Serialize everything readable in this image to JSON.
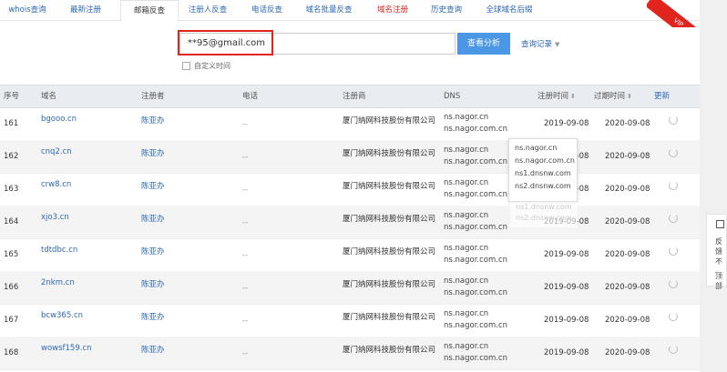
{
  "tabs": [
    {
      "label": "whois查询",
      "state": "normal"
    },
    {
      "label": "最新注册",
      "state": "normal"
    },
    {
      "label": "邮箱反查",
      "state": "active"
    },
    {
      "label": "注册人反查",
      "state": "normal"
    },
    {
      "label": "电话反查",
      "state": "normal"
    },
    {
      "label": "域名批量反查",
      "state": "normal"
    },
    {
      "label": "域名注册",
      "state": "red"
    },
    {
      "label": "历史查询",
      "state": "normal"
    },
    {
      "label": "全球域名后缀",
      "state": "normal"
    }
  ],
  "vip_ribbon": "VIP",
  "search": {
    "value": "**95@gmail.com",
    "button": "查看分析",
    "history": "查询记录",
    "custom_time": "自定义时间"
  },
  "table": {
    "headers": {
      "seq": "序号",
      "domain": "域名",
      "registrant": "注册者",
      "phone": "电话",
      "registrar": "注册商",
      "dns": "DNS",
      "reg_time": "注册时间",
      "exp_time": "过期时间",
      "refresh": "更新"
    },
    "rows": [
      {
        "seq": "161",
        "domain": "bgooo.cn",
        "registrant": "陈亚办",
        "phone": "--",
        "registrar": "厦门纳网科技股份有限公司",
        "dns1": "ns.nagor.cn",
        "dns2": "ns.nagor.com.cn",
        "reg": "2019-09-08",
        "exp": "2020-09-08"
      },
      {
        "seq": "162",
        "domain": "cnq2.cn",
        "registrant": "陈亚办",
        "phone": "--",
        "registrar": "厦门纳网科技股份有限公司",
        "dns1": "ns.nagor.cn",
        "dns2": "ns.nagor.com.cn",
        "reg": "2019-09-08",
        "exp": "2020-09-08"
      },
      {
        "seq": "163",
        "domain": "crw8.cn",
        "registrant": "陈亚办",
        "phone": "--",
        "registrar": "厦门纳网科技股份有限公司",
        "dns1": "ns.nagor.cn",
        "dns2": "ns.nagor.com.cn",
        "reg": "2019-09-08",
        "exp": "2020-09-08"
      },
      {
        "seq": "164",
        "domain": "xjo3.cn",
        "registrant": "陈亚办",
        "phone": "--",
        "registrar": "厦门纳网科技股份有限公司",
        "dns1": "ns.nagor.cn",
        "dns2": "ns.nagor.com.cn",
        "reg": "2019-09-08",
        "exp": "2020-09-08"
      },
      {
        "seq": "165",
        "domain": "tdtdbc.cn",
        "registrant": "陈亚办",
        "phone": "--",
        "registrar": "厦门纳网科技股份有限公司",
        "dns1": "ns.nagor.cn",
        "dns2": "ns.nagor.com.cn",
        "reg": "2019-09-08",
        "exp": "2020-09-08"
      },
      {
        "seq": "166",
        "domain": "2nkm.cn",
        "registrant": "陈亚办",
        "phone": "--",
        "registrar": "厦门纳网科技股份有限公司",
        "dns1": "ns.nagor.cn",
        "dns2": "ns.nagor.com.cn",
        "reg": "2019-09-08",
        "exp": "2020-09-08"
      },
      {
        "seq": "167",
        "domain": "bcw365.cn",
        "registrant": "陈亚办",
        "phone": "--",
        "registrar": "厦门纳网科技股份有限公司",
        "dns1": "ns.nagor.cn",
        "dns2": "ns.nagor.com.cn",
        "reg": "2019-09-08",
        "exp": "2020-09-08"
      },
      {
        "seq": "168",
        "domain": "wowsf159.cn",
        "registrant": "陈亚办",
        "phone": "--",
        "registrar": "厦门纳网科技股份有限公司",
        "dns1": "ns.nagor.cn",
        "dns2": "ns.nagor.com.cn",
        "reg": "2019-09-08",
        "exp": "2020-09-08"
      }
    ]
  },
  "dns_popup": [
    "ns.nagor.cn",
    "ns.nagor.com.cn",
    "ns1.dnsnw.com",
    "ns2.dnsnw.com"
  ],
  "dns_popup_faint": [
    "ns1.dnsnw.com",
    "ns2.dnsnw.com"
  ],
  "side_widget": {
    "label1": "反馈",
    "label2": "不",
    "label3": "顶部"
  },
  "colors": {
    "link": "#2c67b5",
    "accent": "#4b97e6",
    "red": "#e0251f",
    "header_bg": "#e9ecf1"
  }
}
